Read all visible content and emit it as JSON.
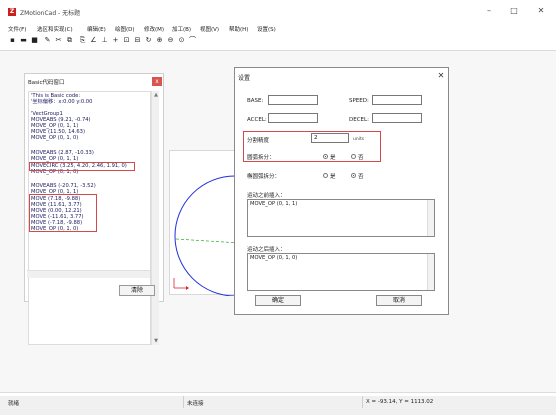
{
  "app": {
    "title": "ZMotionCad - 无标题",
    "logo_letter": "Z"
  },
  "window_controls": {
    "minimize": "–",
    "maximize": "□",
    "close": "✕"
  },
  "menu": [
    "文件(F)",
    "选区和实现(C)",
    "编辑(E)",
    "绘图(D)",
    "修改(M)",
    "加工(B)",
    "视图(V)",
    "帮助(H)",
    "设置(S)"
  ],
  "toolbar_icons": [
    {
      "name": "new-file-icon",
      "glyph": "▪"
    },
    {
      "name": "open-folder-icon",
      "glyph": "▬"
    },
    {
      "name": "save-icon",
      "glyph": "■"
    },
    {
      "name": "pencil-icon",
      "glyph": "✎"
    },
    {
      "name": "cut-icon",
      "glyph": "✂"
    },
    {
      "name": "copy-icon",
      "glyph": "⧉"
    },
    {
      "name": "paste-icon",
      "glyph": "⎘"
    },
    {
      "name": "angle-icon",
      "glyph": "∠"
    },
    {
      "name": "line-icon",
      "glyph": "⊥"
    },
    {
      "name": "cross-icon",
      "glyph": "+"
    },
    {
      "name": "lock-icon",
      "glyph": "⊡"
    },
    {
      "name": "unlock-icon",
      "glyph": "⊟"
    },
    {
      "name": "rotate-icon",
      "glyph": "↻"
    },
    {
      "name": "zoom-in-icon",
      "glyph": "⊕"
    },
    {
      "name": "zoom-out-icon",
      "glyph": "⊖"
    },
    {
      "name": "zoom-fit-icon",
      "glyph": "⊙"
    },
    {
      "name": "pan-icon",
      "glyph": "⌒"
    }
  ],
  "basic_window": {
    "title": "Basic代码窗口",
    "close": "x",
    "code_lines": [
      "'This is Basic code:",
      "'坐标偏移：x:0.00 y:0.00",
      "",
      "'VectGroup1",
      "MOVEABS (9.21, -0.74)",
      "MOVE_OP (0, 1, 1)",
      "MOVE (11.50, 14.63)",
      "MOVE_OP (0, 1, 0)",
      "",
      "MOVEABS (2.87, -10.33)",
      "MOVE_OP (0, 1, 1)",
      "MOVECIRC (3.25, 4.20, 2.46, 1.91, 0)",
      "MOVE_OP (0, 1, 0)",
      "",
      "MOVEABS (-20.71, -3.52)",
      "MOVE_OP (0, 1, 1)",
      "MOVE (7.18, -9.88)",
      "MOVE (11.61, 3.77)",
      "MOVE (0.00, 12.21)",
      "MOVE (-11.61, 3.77)",
      "MOVE (-7.18, -9.88)",
      "MOVE_OP (0, 1, 0)"
    ],
    "clear_label": "清除"
  },
  "dialog": {
    "title": "设置",
    "close": "✕",
    "base_label": "BASE:",
    "speed_label": "SPEED:",
    "accel_label": "ACCEL:",
    "decel_label": "DECEL:",
    "split_precision_label": "分割精度",
    "split_precision_value": "2",
    "split_precision_unit": "units",
    "circle_split_label": "圆弧拆分：",
    "circle_split_yes": "是",
    "circle_split_no": "否",
    "ellipse_split_label": "椭圆弧拆分：",
    "ellipse_split_yes": "是",
    "ellipse_split_no": "否",
    "before_motion_label": "运动之前插入：",
    "before_motion_text": "MOVE_OP (0, 1, 1)",
    "after_motion_label": "运动之后插入：",
    "after_motion_text": "MOVE_OP (0, 1, 0)",
    "ok_label": "确定",
    "cancel_label": "取消"
  },
  "status": {
    "left": "就绪",
    "middle": "未连接",
    "coords": "X = -93.14, Y = 1113.02"
  }
}
